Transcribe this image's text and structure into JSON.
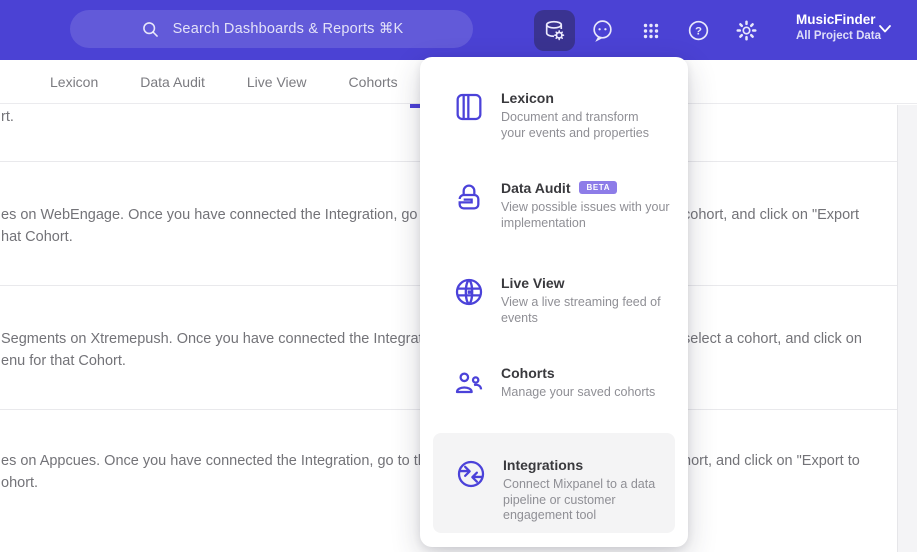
{
  "header": {
    "search": {
      "placeholder": "Search Dashboards & Reports ⌘K"
    },
    "project": {
      "name": "MusicFinder",
      "subtitle": "All Project Data"
    }
  },
  "tabs": [
    {
      "label": "Lexicon"
    },
    {
      "label": "Data Audit"
    },
    {
      "label": "Live View"
    },
    {
      "label": "Cohorts"
    }
  ],
  "menu": {
    "items": [
      {
        "title": "Lexicon",
        "badge": "",
        "description": "Document and transform your events and properties"
      },
      {
        "title": "Data Audit",
        "badge": "BETA",
        "description": "View possible issues with your implementation"
      },
      {
        "title": "Live View",
        "badge": "",
        "description": "View a live streaming feed of events"
      },
      {
        "title": "Cohorts",
        "badge": "",
        "description": "Manage your saved cohorts"
      },
      {
        "title": "Integrations",
        "badge": "",
        "description": "Connect Mixpanel to a data pipeline or customer engagement tool"
      }
    ]
  },
  "background_rows": [
    {
      "line1_left": "rt.",
      "line1_right": "",
      "line2": ""
    },
    {
      "line1_left": "es on WebEngage. Once you have connected the Integration, go to the",
      "line1_right": "cohort, and click on \"Export",
      "line2": "hat Cohort."
    },
    {
      "line1_left": "Segments on Xtremepush. Once you have connected the Integration,",
      "line1_right": "select a cohort, and click on",
      "line2": "enu for that Cohort."
    },
    {
      "line1_left": "es on Appcues. Once you have connected the Integration, go to the M",
      "line1_right": "hort, and click on \"Export to",
      "line2": "ohort."
    }
  ],
  "colors": {
    "header_bg": "#4b42d4",
    "accent": "#4c41d8",
    "icon_indigo": "#4b42d9",
    "badge_bg": "#8d7ce8",
    "highlight_bg": "#f4f4f5"
  }
}
